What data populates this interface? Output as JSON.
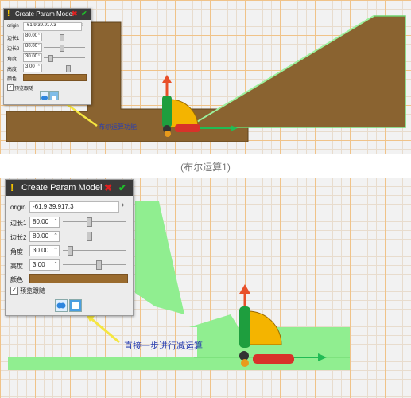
{
  "shot1": {
    "panel": {
      "title": "Create Param Model",
      "warn_icon": "!",
      "close_icon": "✖",
      "confirm_icon": "✔",
      "origin_label": "origin",
      "origin_value": "-61.9,39.917.3",
      "rows": [
        {
          "label": "边长1",
          "value": "80.00",
          "slider": 0.4
        },
        {
          "label": "边长2",
          "value": "80.00",
          "slider": 0.4
        },
        {
          "label": "角度",
          "value": "30.00",
          "slider": 0.15
        },
        {
          "label": "高度",
          "value": "3.00",
          "slider": 0.55
        }
      ],
      "color_label": "颜色",
      "preview_label": "预览跟随"
    },
    "annotation": "布尔运算功能"
  },
  "caption": "(布尔运算1)",
  "shot2": {
    "panel": {
      "title": "Create Param Model",
      "warn_icon": "!",
      "close_icon": "✖",
      "confirm_icon": "✔",
      "origin_label": "origin",
      "origin_value": "-61.9,39.917.3",
      "rows": [
        {
          "label": "边长1",
          "value": "80.00",
          "slider": 0.4
        },
        {
          "label": "边长2",
          "value": "80.00",
          "slider": 0.4
        },
        {
          "label": "角度",
          "value": "30.00",
          "slider": 0.1
        },
        {
          "label": "高度",
          "value": "3.00",
          "slider": 0.55
        }
      ],
      "color_label": "颜色",
      "preview_label": "预览跟随"
    },
    "annotation": "直接一步进行减运算"
  },
  "colors": {
    "model_brown": "#8a6330",
    "model_green": "#90ee90",
    "panel_title_bg": "#3a3a3a",
    "swatch": "#9a6b2e",
    "annotation_blue": "#2a3fb0",
    "highlight_ellipse": "#3a8ee0",
    "arrow_yellow": "#f5e640"
  },
  "icons": [
    "warning-icon",
    "close-icon",
    "check-icon",
    "boolean-union-icon",
    "boolean-subtract-icon",
    "translate-gizmo",
    "rotate-gizmo"
  ]
}
